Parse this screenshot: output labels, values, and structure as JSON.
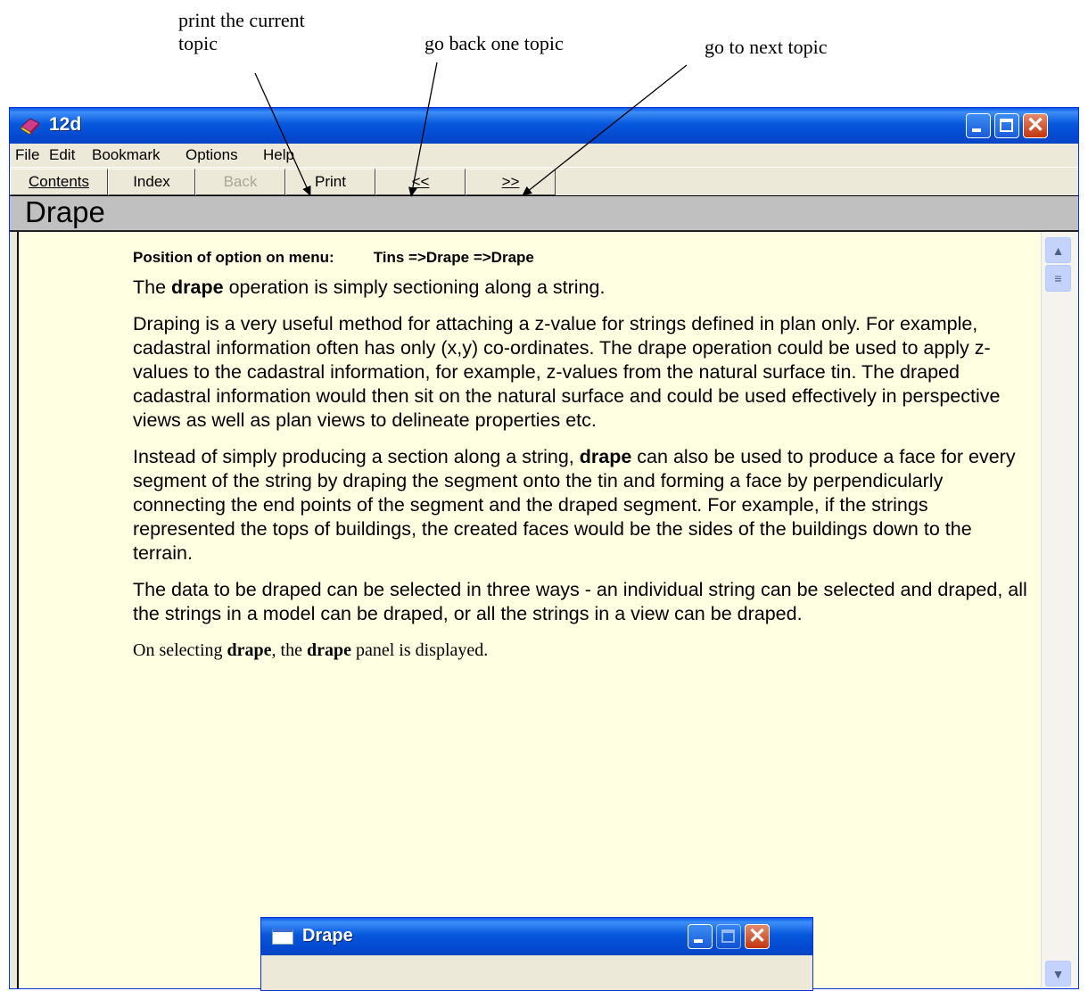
{
  "annotations": {
    "print": "print the current topic",
    "back": "go back one topic",
    "next": "go to next topic"
  },
  "window": {
    "title": "12d",
    "icon": "book-icon"
  },
  "menu": [
    "File",
    "Edit",
    "Bookmark",
    "Options",
    "Help"
  ],
  "toolbar": {
    "contents": "Contents",
    "index": "Index",
    "back": "Back",
    "print": "Print",
    "prev": "<<",
    "next": ">>"
  },
  "topic": {
    "title": "Drape"
  },
  "content": {
    "position_label": "Position of option on menu:",
    "position_value": "Tins =>Drape =>Drape",
    "p1_a": "The ",
    "p1_b": "drape",
    "p1_c": " operation is simply sectioning along a string.",
    "p2": "Draping is a very useful method for attaching a z-value for strings defined in plan only. For example, cadastral information often has only (x,y) co-ordinates. The drape operation could be used to apply z-values to the cadastral information, for example, z-values from the natural surface tin. The draped cadastral information would then sit on the natural surface and could be used effectively in perspective views as well as plan views to delineate properties etc.",
    "p3_a": "Instead of simply producing a section along a string, ",
    "p3_b": "drape",
    "p3_c": " can also be used to produce a face for every segment of the string by draping the segment onto the tin and forming a face by perpendicularly connecting the end points of the segment and the draped segment. For example, if the strings represented the tops of buildings, the created faces would be the sides of the buildings down to the terrain.",
    "p4": "The data to be draped can be selected in three ways - an individual string can be selected and draped, all the strings in a model can be draped, or all the strings in a view can be draped.",
    "p5_a": "On selecting ",
    "p5_b": "drape",
    "p5_c": ", the ",
    "p5_d": "drape",
    "p5_e": " panel is displayed."
  },
  "panel": {
    "title": "Drape"
  },
  "colors": {
    "titlebar": "#0758dd",
    "content_bg": "#ffffe1",
    "topic_bar": "#c0c0c0",
    "close_button": "#c2350e"
  }
}
